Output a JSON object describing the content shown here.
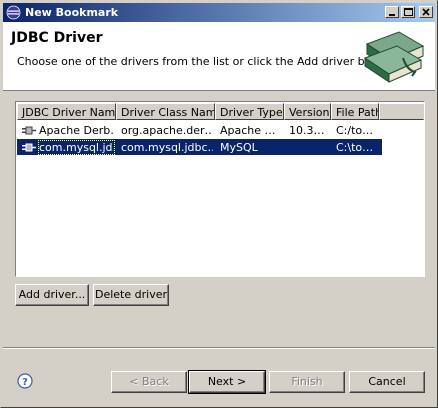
{
  "window": {
    "title": "New Bookmark"
  },
  "header": {
    "title": "JDBC Driver",
    "description": "Choose one of the drivers from the list or click the Add driver button"
  },
  "table": {
    "columns": [
      "JDBC Driver Name",
      "Driver Class Name",
      "Driver Type",
      "Version",
      "File Path"
    ],
    "rows": [
      {
        "name": "Apache Derb…",
        "class_name": "org.apache.der…",
        "type": "Apache …",
        "version": "10.3…",
        "path": "C:/to…",
        "selected": false
      },
      {
        "name": "com.mysql.jd…",
        "class_name": "com.mysql.jdbc…",
        "type": "MySQL",
        "version": "",
        "path": "C:\\to…",
        "selected": true
      }
    ]
  },
  "buttons": {
    "add_driver": "Add driver...",
    "delete_driver": "Delete driver",
    "back": "< Back",
    "next": "Next >",
    "finish": "Finish",
    "cancel": "Cancel"
  },
  "icons": {
    "app": "eclipse-icon",
    "banner": "book-stack-icon",
    "driver": "plug-icon",
    "help": "help-icon"
  },
  "colors": {
    "title_start": "#0a246a",
    "title_end": "#a6caf0",
    "selection": "#0a246a"
  }
}
